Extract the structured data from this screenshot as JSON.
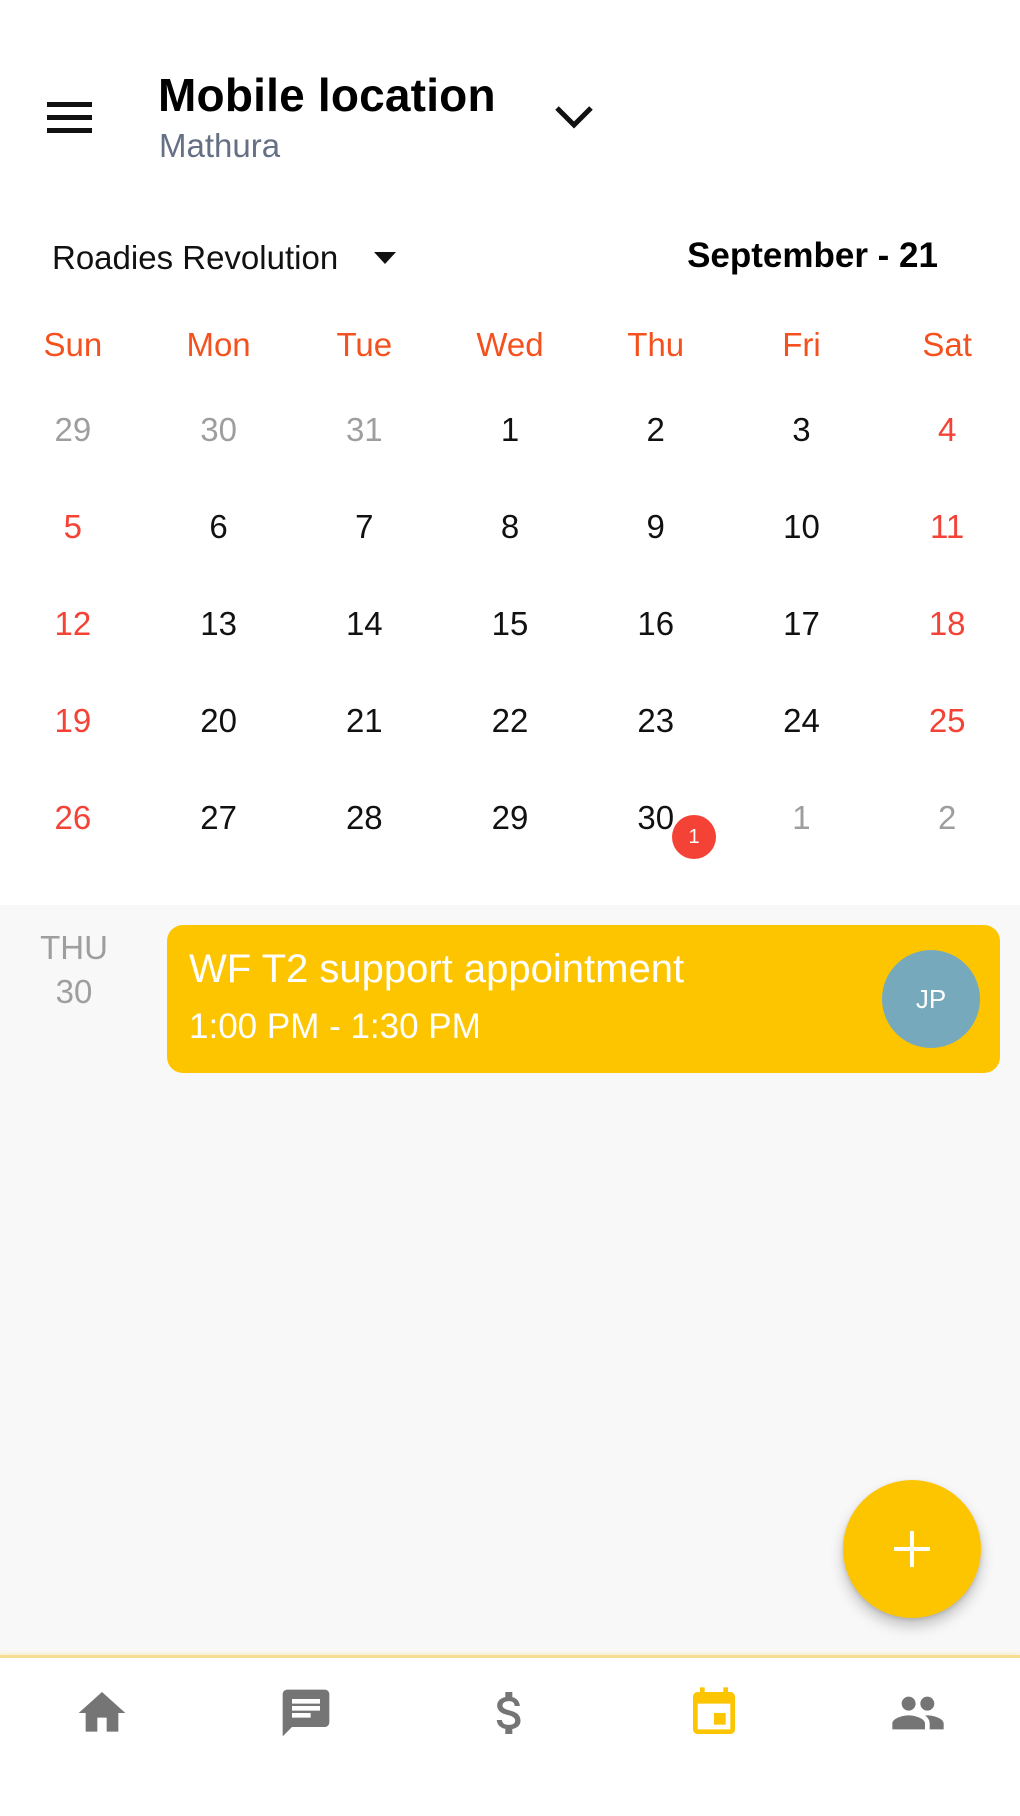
{
  "header": {
    "menu_icon": "hamburger-menu-icon",
    "title": "Mobile location",
    "subtitle": "Mathura",
    "title_dropdown_icon": "chevron-down-icon"
  },
  "toolbar": {
    "team_selector": {
      "value": "Roadies Revolution",
      "icon": "caret-down-icon"
    },
    "month_label": "September - 21"
  },
  "calendar": {
    "weekdays": [
      "Sun",
      "Mon",
      "Tue",
      "Wed",
      "Thu",
      "Fri",
      "Sat"
    ],
    "weeks": [
      [
        {
          "d": "29",
          "t": "other"
        },
        {
          "d": "30",
          "t": "other"
        },
        {
          "d": "31",
          "t": "other"
        },
        {
          "d": "1",
          "t": "cur"
        },
        {
          "d": "2",
          "t": "cur"
        },
        {
          "d": "3",
          "t": "cur"
        },
        {
          "d": "4",
          "t": "weekend"
        }
      ],
      [
        {
          "d": "5",
          "t": "weekend"
        },
        {
          "d": "6",
          "t": "cur"
        },
        {
          "d": "7",
          "t": "cur"
        },
        {
          "d": "8",
          "t": "cur"
        },
        {
          "d": "9",
          "t": "cur"
        },
        {
          "d": "10",
          "t": "cur"
        },
        {
          "d": "11",
          "t": "weekend"
        }
      ],
      [
        {
          "d": "12",
          "t": "weekend"
        },
        {
          "d": "13",
          "t": "cur"
        },
        {
          "d": "14",
          "t": "cur"
        },
        {
          "d": "15",
          "t": "cur"
        },
        {
          "d": "16",
          "t": "cur"
        },
        {
          "d": "17",
          "t": "cur"
        },
        {
          "d": "18",
          "t": "weekend"
        }
      ],
      [
        {
          "d": "19",
          "t": "weekend"
        },
        {
          "d": "20",
          "t": "cur"
        },
        {
          "d": "21",
          "t": "cur"
        },
        {
          "d": "22",
          "t": "cur"
        },
        {
          "d": "23",
          "t": "cur"
        },
        {
          "d": "24",
          "t": "cur"
        },
        {
          "d": "25",
          "t": "weekend"
        }
      ],
      [
        {
          "d": "26",
          "t": "weekend"
        },
        {
          "d": "27",
          "t": "cur"
        },
        {
          "d": "28",
          "t": "cur"
        },
        {
          "d": "29",
          "t": "cur"
        },
        {
          "d": "30",
          "t": "cur",
          "badge": "1"
        },
        {
          "d": "1",
          "t": "other"
        },
        {
          "d": "2",
          "t": "other"
        }
      ]
    ]
  },
  "events": {
    "date_weekday": "THU",
    "date_day": "30",
    "items": [
      {
        "title": "WF T2 support appointment",
        "time": "1:00 PM - 1:30 PM",
        "avatar_initials": "JP"
      }
    ]
  },
  "fab": {
    "icon": "plus-icon",
    "label": "Add"
  },
  "bottom_nav": {
    "items": [
      {
        "name": "home",
        "icon": "home-icon",
        "active": false
      },
      {
        "name": "messages",
        "icon": "chat-icon",
        "active": false
      },
      {
        "name": "payments",
        "icon": "dollar-icon",
        "active": false
      },
      {
        "name": "calendar",
        "icon": "calendar-icon",
        "active": true
      },
      {
        "name": "people",
        "icon": "people-icon",
        "active": false
      }
    ]
  },
  "colors": {
    "accent": "#fdc500",
    "weekday_header": "#f4511e",
    "weekend": "#f44336",
    "muted": "#9e9e9e",
    "avatar": "#76a9bb",
    "nav_icon": "#757575",
    "subtitle": "#667085"
  }
}
